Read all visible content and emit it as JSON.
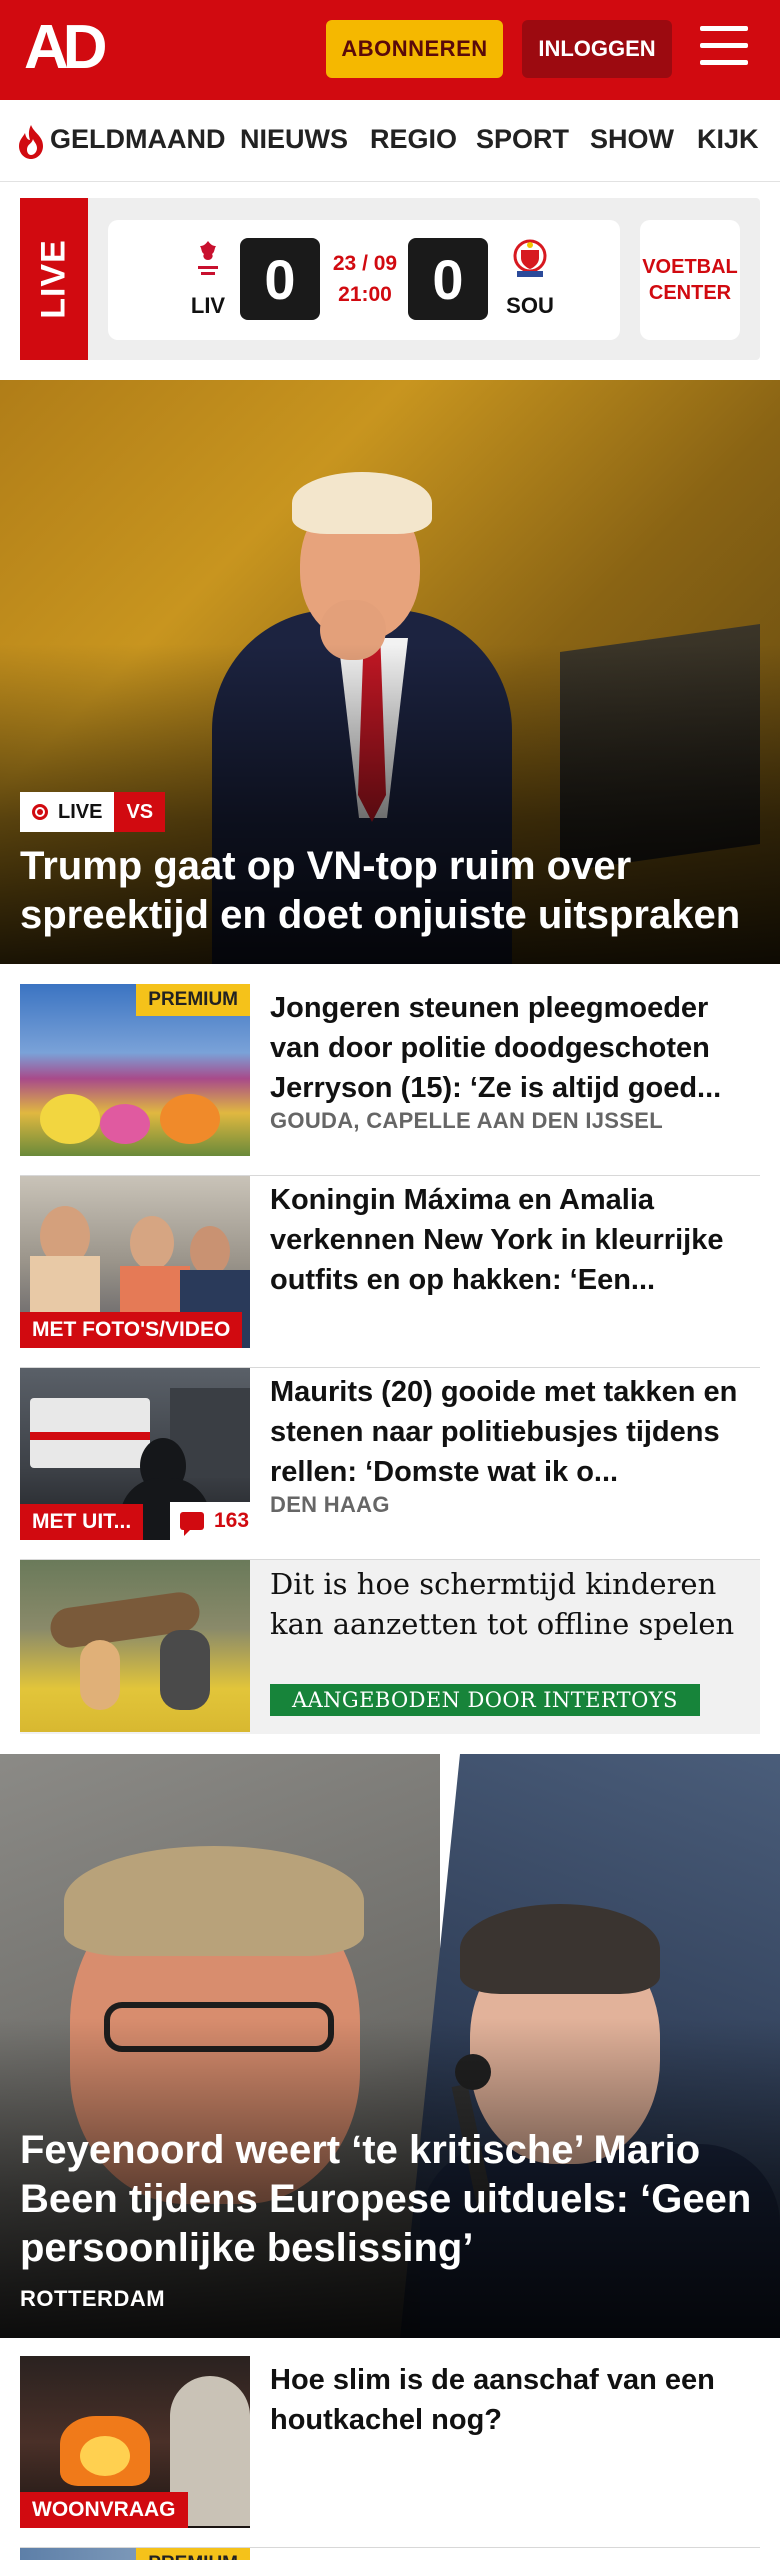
{
  "header": {
    "logo_text": "AD",
    "subscribe_label": "ABONNEREN",
    "login_label": "INLOGGEN",
    "menu_icon": "hamburger-icon",
    "brand_color": "#d10a10"
  },
  "nav": {
    "items": [
      "GELDMAAND",
      "NIEUWS",
      "REGIO",
      "SPORT",
      "SHOW",
      "KIJK"
    ],
    "first_icon": "flame-icon"
  },
  "live_widget": {
    "tag": "LIVE",
    "home": {
      "abbr": "LIV",
      "score": "0",
      "crest_icon": "liverpool-crest-icon"
    },
    "away": {
      "abbr": "SOU",
      "score": "0",
      "crest_icon": "southampton-crest-icon"
    },
    "date": "23 / 09",
    "time": "21:00",
    "voetbal_center": "VOETBAL CENTER"
  },
  "hero1": {
    "badge_live": "LIVE",
    "badge_vs": "VS",
    "title": "Trump gaat op VN-top ruim over spreektijd en doet onjuiste uitspraken"
  },
  "articles": [
    {
      "title": "Jongeren steunen pleegmoeder van door politie doodgeschoten Jerryson (15): ‘Ze is altijd goed...",
      "location": "GOUDA, CAPELLE AAN DEN IJSSEL",
      "premium": "PREMIUM"
    },
    {
      "title": "Koningin Máxima en Amalia verkennen New York in kleurrijke outfits en op hakken: ‘Een...",
      "label": "MET FOTO'S/VIDEO"
    },
    {
      "title": "Maurits (20) gooide met takken en stenen naar politiebusjes tijdens rellen: ‘Domste wat ik o...",
      "location": "DEN HAAG",
      "label": "MET UIT...",
      "comments": "163"
    },
    {
      "title": "Dit is hoe schermtijd kinderen kan aanzetten tot offline spelen",
      "sponsor": "AANGEBODEN DOOR INTERTOYS"
    }
  ],
  "hero2": {
    "title": "Feyenoord weert ‘te kritische’ Mario Been tijdens Europese uitduels: ‘Geen persoonlijke beslissing’",
    "location": "ROTTERDAM"
  },
  "article5": {
    "title": "Hoe slim is de aanschaf van een houtkachel nog?",
    "label": "WOONVRAAG"
  },
  "article6": {
    "premium": "PREMIUM"
  }
}
